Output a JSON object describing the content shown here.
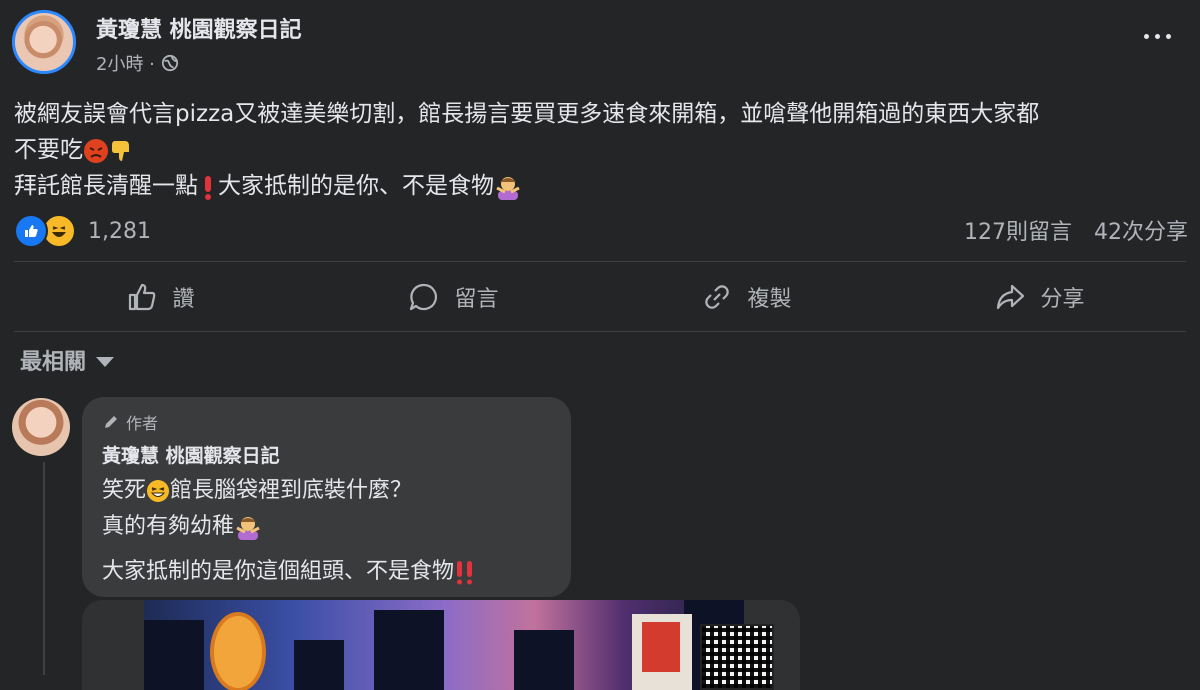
{
  "post": {
    "author": "黃瓊慧 桃園觀察日記",
    "time": "2小時 ·",
    "text_line1": "被網友誤會代言pizza又被達美樂切割，館長揚言要買更多速食來開箱，並嗆聲他開箱過的東西大家都",
    "text_line2": "不要吃",
    "text_line3": "拜託館長清醒一點",
    "text_line3b": "大家抵制的是你、不是食物",
    "reaction_count": "1,281",
    "comments_count": "127則留言",
    "shares_count": "42次分享"
  },
  "actions": {
    "like": "讚",
    "comment": "留言",
    "copy": "複製",
    "share": "分享"
  },
  "sort": {
    "label": "最相關"
  },
  "comment": {
    "badge": "作者",
    "author": "黃瓊慧 桃園觀察日記",
    "line1a": "笑死",
    "line1b": "館長腦袋裡到底裝什麼？",
    "line2": "真的有夠幼稚",
    "line3": "大家抵制的是你這個組頭、不是食物"
  },
  "icons": {
    "globe": "globe-icon",
    "more": "more-options-icon",
    "like": "thumbs-up-icon",
    "comment": "speech-bubble-icon",
    "copy": "link-icon",
    "share": "share-arrow-icon"
  },
  "colors": {
    "background": "#242526",
    "text": "#e4e6eb",
    "secondary": "#b0b3b8",
    "bubble": "#3a3b3c",
    "accent": "#2d88ff"
  }
}
